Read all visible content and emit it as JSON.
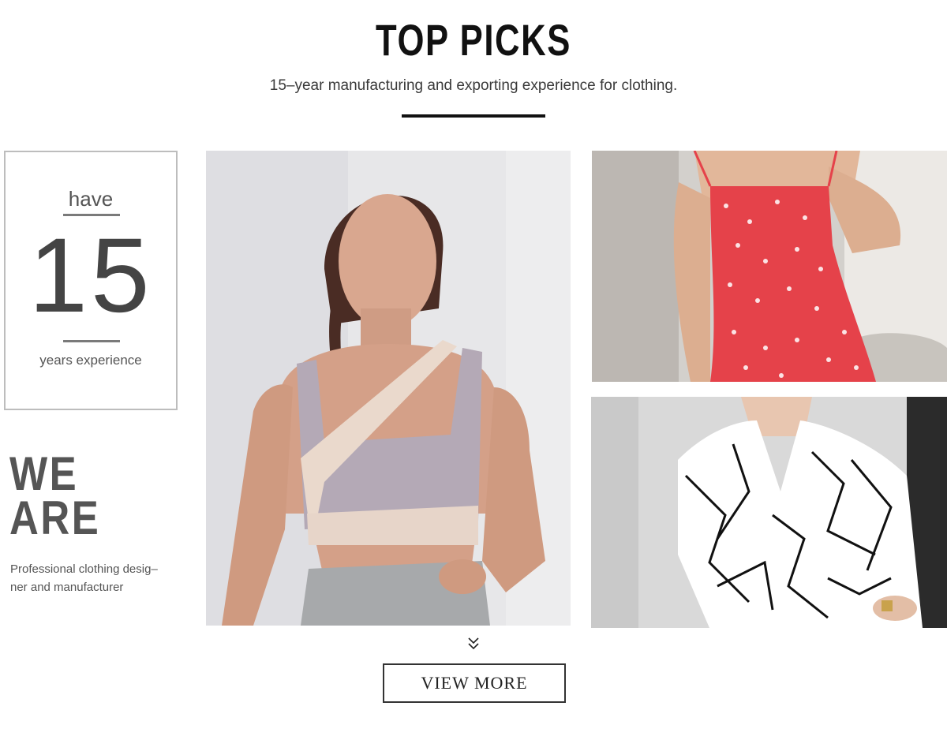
{
  "header": {
    "title": "TOP PICKS",
    "subtitle": "15–year manufacturing and exporting experience for clothing."
  },
  "experience": {
    "have": "have",
    "number": "15",
    "years": "years experience"
  },
  "about": {
    "heading_line1": "WE",
    "heading_line2": "ARE",
    "desc_line1": "Professional clothing desig–",
    "desc_line2": "ner and manufacturer"
  },
  "gallery": {
    "items": [
      {
        "name": "sports-bra-photo",
        "colors": {
          "bg": "#e7e7e9",
          "garment": "#b4a9b6",
          "accent": "#ead9cc"
        }
      },
      {
        "name": "red-floral-dress-photo",
        "colors": {
          "bg": "#d3d0cc",
          "garment": "#e5424a",
          "accent": "#ffffff"
        }
      },
      {
        "name": "geometric-shirt-photo",
        "colors": {
          "bg": "#d9d9d9",
          "garment": "#ffffff",
          "accent": "#111111"
        }
      }
    ]
  },
  "cta": {
    "icon": "double-chevron-down-icon",
    "label": "VIEW MORE"
  }
}
